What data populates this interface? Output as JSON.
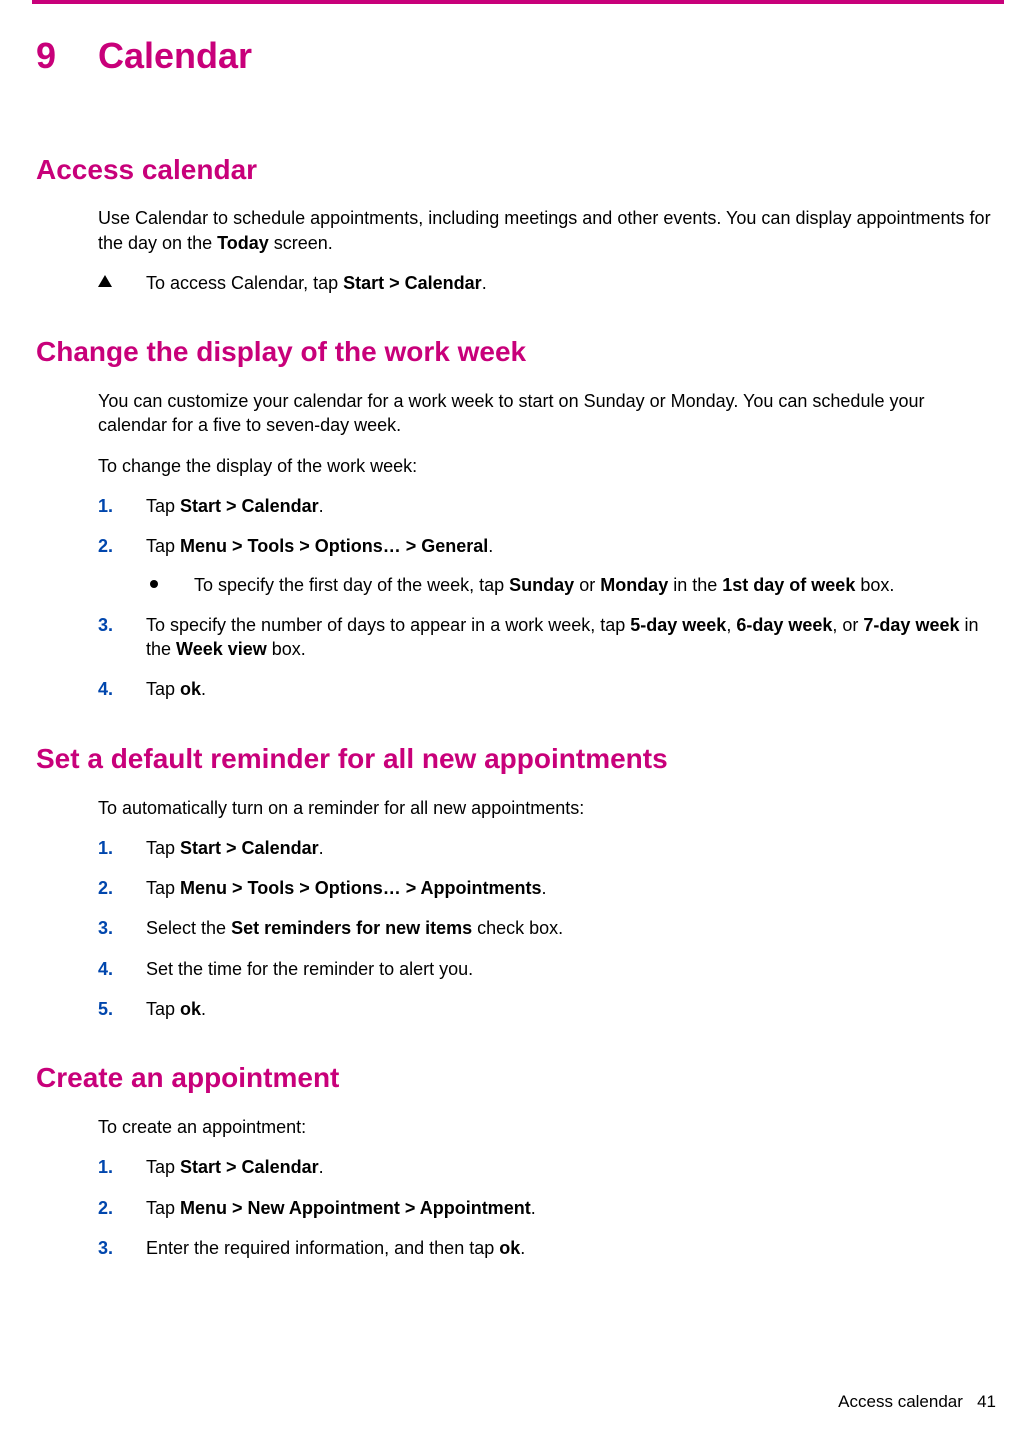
{
  "chapter": {
    "number": "9",
    "title": "Calendar"
  },
  "sections": {
    "access": {
      "heading": "Access calendar",
      "intro_html": "Use Calendar to schedule appointments, including meetings and other events. You can display appointments for the day on the <b>Today</b> screen.",
      "bullet_html": "To access Calendar, tap <b>Start > Calendar</b>."
    },
    "workweek": {
      "heading": "Change the display of the work week",
      "intro": "You can customize your calendar for a work week to start on Sunday or Monday. You can schedule your calendar for a five to seven-day week.",
      "lead": "To change the display of the work week:",
      "steps": [
        {
          "html": "Tap <b>Start > Calendar</b>."
        },
        {
          "html": "Tap <b>Menu > Tools > Options… > General</b>.",
          "sub": [
            {
              "html": "To specify the first day of the week, tap <b>Sunday</b> or <b>Monday</b> in the <b>1st day of week</b> box."
            }
          ]
        },
        {
          "html": "To specify the number of days to appear in a work week, tap <b>5-day week</b>, <b>6-day week</b>, or <b>7-day week</b> in the <b>Week view</b> box."
        },
        {
          "html": "Tap <b>ok</b>."
        }
      ]
    },
    "reminder": {
      "heading": "Set a default reminder for all new appointments",
      "lead": "To automatically turn on a reminder for all new appointments:",
      "steps": [
        {
          "html": "Tap <b>Start > Calendar</b>."
        },
        {
          "html": "Tap <b>Menu > Tools > Options… > Appointments</b>."
        },
        {
          "html": "Select the <b>Set reminders for new items</b> check box."
        },
        {
          "html": "Set the time for the reminder to alert you."
        },
        {
          "html": "Tap <b>ok</b>."
        }
      ]
    },
    "create": {
      "heading": "Create an appointment",
      "lead": "To create an appointment:",
      "steps": [
        {
          "html": "Tap <b>Start > Calendar</b>."
        },
        {
          "html": "Tap <b>Menu > New Appointment > Appointment</b>."
        },
        {
          "html": "Enter the required information, and then tap <b>ok</b>."
        }
      ]
    }
  },
  "footer": {
    "title": "Access calendar",
    "page": "41"
  }
}
